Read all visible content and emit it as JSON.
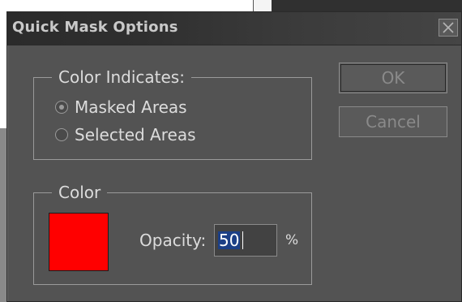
{
  "dialog": {
    "title": "Quick Mask Options",
    "close_icon": "close-icon"
  },
  "color_indicates": {
    "legend": "Color Indicates:",
    "options": [
      {
        "label": "Masked Areas",
        "checked": true
      },
      {
        "label": "Selected Areas",
        "checked": false
      }
    ]
  },
  "color_group": {
    "legend": "Color",
    "swatch_color": "#ff0000",
    "opacity_label": "Opacity:",
    "opacity_value": "50",
    "percent": "%"
  },
  "buttons": {
    "ok": "OK",
    "cancel": "Cancel"
  }
}
